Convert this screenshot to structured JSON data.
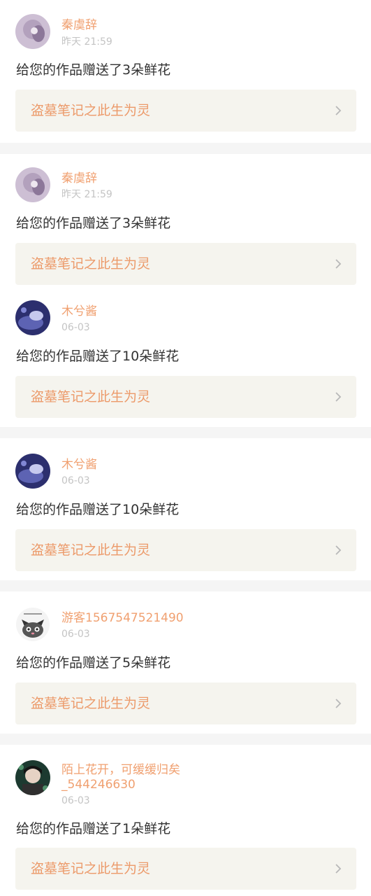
{
  "notifications": [
    {
      "user": {
        "name": "秦虞辞",
        "avatar_icon": "user-avatar-photo"
      },
      "time": "昨天 21:59",
      "message": "给您的作品赠送了3朵鲜花",
      "work_title": "盗墓笔记之此生为灵"
    },
    {
      "user": {
        "name": "秦虞辞",
        "avatar_icon": "user-avatar-photo"
      },
      "time": "昨天 21:59",
      "message": "给您的作品赠送了3朵鲜花",
      "work_title": "盗墓笔记之此生为灵"
    },
    {
      "user": {
        "name": "木兮酱",
        "avatar_icon": "user-avatar-photo"
      },
      "time": "06-03",
      "message": "给您的作品赠送了10朵鲜花",
      "work_title": "盗墓笔记之此生为灵"
    },
    {
      "user": {
        "name": "木兮酱",
        "avatar_icon": "user-avatar-photo"
      },
      "time": "06-03",
      "message": "给您的作品赠送了10朵鲜花",
      "work_title": "盗墓笔记之此生为灵"
    },
    {
      "user": {
        "name": "游客1567547521490",
        "avatar_icon": "cat-avatar-illustration"
      },
      "time": "06-03",
      "message": "给您的作品赠送了5朵鲜花",
      "work_title": "盗墓笔记之此生为灵"
    },
    {
      "user": {
        "name": "陌上花开，可缓缓归矣",
        "name_line2": "_544246630",
        "avatar_icon": "user-avatar-photo"
      },
      "time": "06-03",
      "message": "给您的作品赠送了1朵鲜花",
      "work_title": "盗墓笔记之此生为灵"
    }
  ],
  "icons": {
    "card_arrow": "chevron-right-icon"
  },
  "colors": {
    "username": "#f0a070",
    "time": "#c4c4c4",
    "message": "#333333",
    "work_title": "#ec9a6a",
    "card_background": "#f5f4ee",
    "separator": "#f5f5f5"
  }
}
